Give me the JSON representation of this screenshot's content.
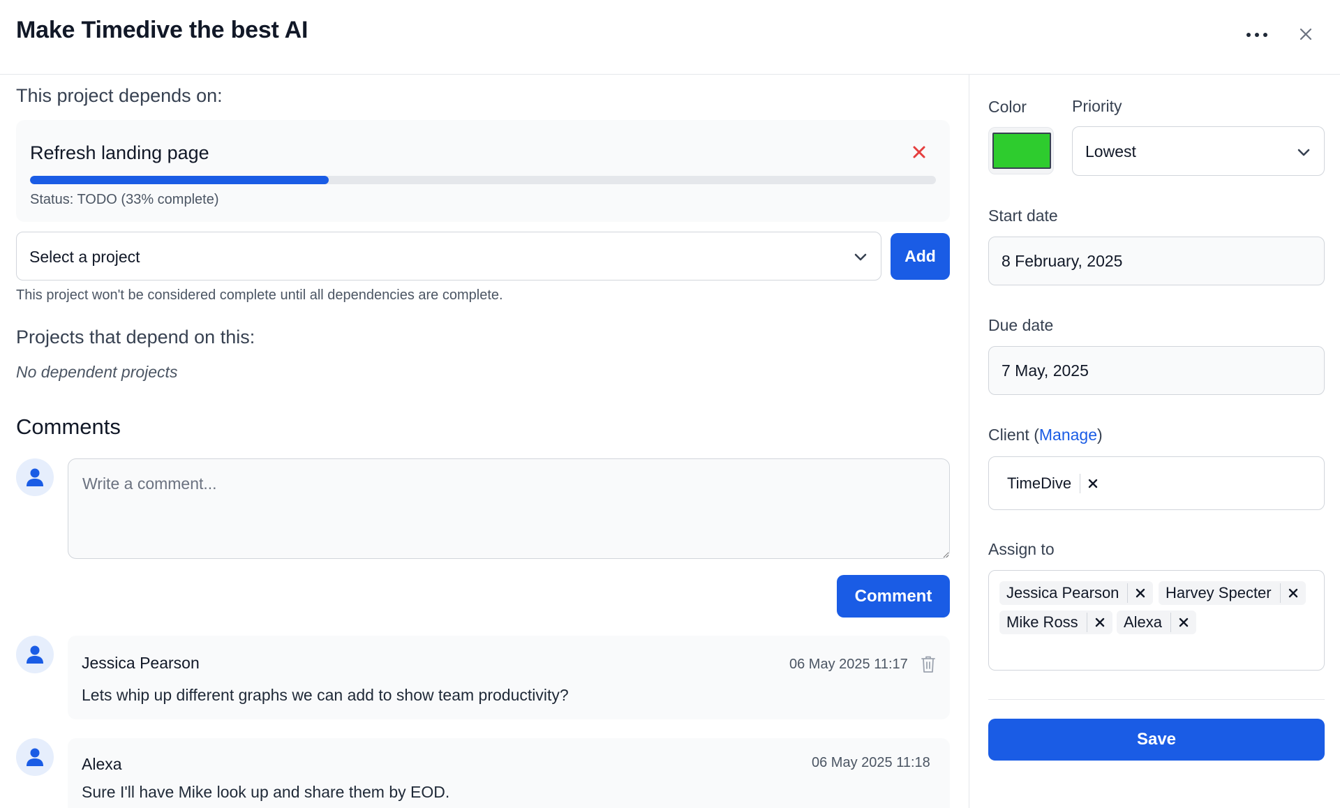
{
  "modal": {
    "title": "Make Timedive the best AI"
  },
  "dependencies": {
    "heading": "This project depends on:",
    "items": [
      {
        "name": "Refresh landing page",
        "progress_percent": 33,
        "status": "Status: TODO (33% complete)"
      }
    ],
    "select_placeholder": "Select a project",
    "add_label": "Add",
    "help_text": "This project won't be considered complete until all dependencies are complete."
  },
  "dependents": {
    "heading": "Projects that depend on this:",
    "empty_text": "No dependent projects"
  },
  "comments": {
    "heading": "Comments",
    "placeholder": "Write a comment...",
    "submit_label": "Comment",
    "items": [
      {
        "author": "Jessica Pearson",
        "timestamp": "06 May 2025 11:17",
        "text": "Lets whip up different graphs we can add to show team productivity?",
        "deletable": true
      },
      {
        "author": "Alexa",
        "timestamp": "06 May 2025 11:18",
        "text": "Sure I'll have Mike look up and share them by EOD.",
        "deletable": false
      }
    ]
  },
  "sidebar": {
    "color_label": "Color",
    "color_value": "#2ecc2e",
    "priority_label": "Priority",
    "priority_value": "Lowest",
    "start_date_label": "Start date",
    "start_date_value": "8 February, 2025",
    "due_date_label": "Due date",
    "due_date_value": "7 May, 2025",
    "client_label": "Client",
    "client_paren_open": "(",
    "client_manage_label": "Manage",
    "client_paren_close": ")",
    "client_value": "TimeDive",
    "assign_label": "Assign to",
    "assignees": [
      "Jessica Pearson",
      "Harvey Specter",
      "Mike Ross",
      "Alexa"
    ],
    "save_label": "Save"
  },
  "colors": {
    "accent": "#1a5ce5",
    "remove_red": "#e53e3e"
  }
}
